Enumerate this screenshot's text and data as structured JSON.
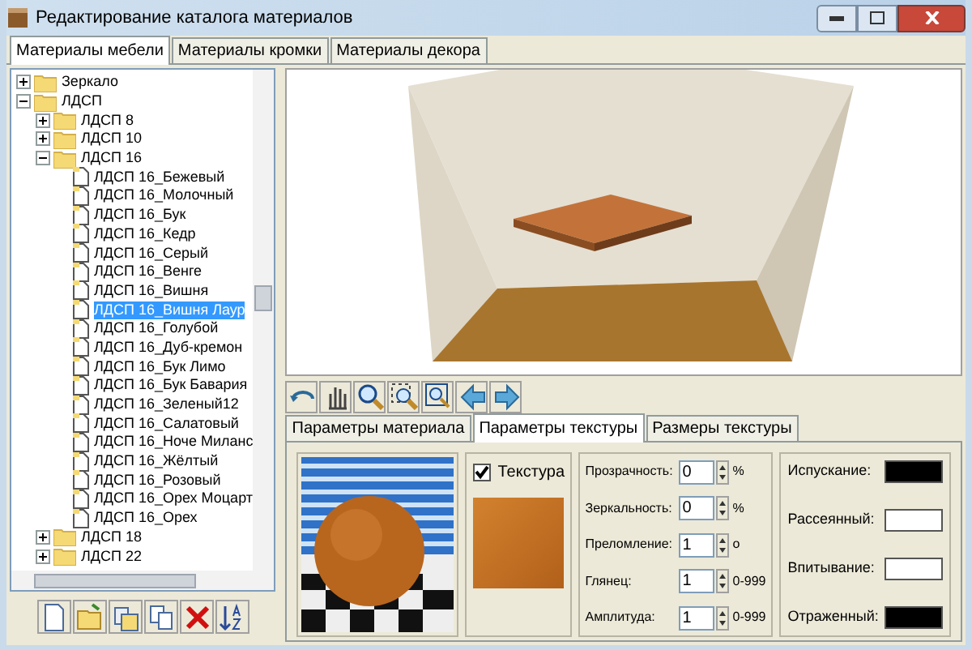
{
  "window": {
    "title": "Редактирование каталога материалов"
  },
  "tabs": [
    {
      "label": "Материалы мебели",
      "selected": true
    },
    {
      "label": "Материалы кромки",
      "selected": false
    },
    {
      "label": "Материалы декора",
      "selected": false
    }
  ],
  "tree": [
    {
      "kind": "folder",
      "label": "Зеркало",
      "expanded": false,
      "selected": false
    },
    {
      "kind": "folder",
      "label": "ЛДСП",
      "expanded": true,
      "selected": false,
      "children": [
        {
          "kind": "folder",
          "label": "ЛДСП 8",
          "expanded": false,
          "selected": false
        },
        {
          "kind": "folder",
          "label": "ЛДСП 10",
          "expanded": false,
          "selected": false
        },
        {
          "kind": "folder",
          "label": "ЛДСП 16",
          "expanded": true,
          "selected": false,
          "children": [
            {
              "kind": "material",
              "label": "ЛДСП 16_Бежевый",
              "selected": false
            },
            {
              "kind": "material",
              "label": "ЛДСП 16_Молочный",
              "selected": false
            },
            {
              "kind": "material",
              "label": "ЛДСП 16_Бук",
              "selected": false
            },
            {
              "kind": "material",
              "label": "ЛДСП 16_Кедр",
              "selected": false
            },
            {
              "kind": "material",
              "label": "ЛДСП 16_Серый",
              "selected": false
            },
            {
              "kind": "material",
              "label": "ЛДСП 16_Венге",
              "selected": false
            },
            {
              "kind": "material",
              "label": "ЛДСП 16_Вишня",
              "selected": false
            },
            {
              "kind": "material",
              "label": "ЛДСП 16_Вишня Лаур",
              "selected": true
            },
            {
              "kind": "material",
              "label": "ЛДСП 16_Голубой",
              "selected": false
            },
            {
              "kind": "material",
              "label": "ЛДСП 16_Дуб-кремон",
              "selected": false
            },
            {
              "kind": "material",
              "label": "ЛДСП 16_Бук Лимо",
              "selected": false
            },
            {
              "kind": "material",
              "label": "ЛДСП 16_Бук Бавария",
              "selected": false
            },
            {
              "kind": "material",
              "label": "ЛДСП 16_Зеленый12",
              "selected": false
            },
            {
              "kind": "material",
              "label": "ЛДСП 16_Салатовый",
              "selected": false
            },
            {
              "kind": "material",
              "label": "ЛДСП 16_Ноче Миланс",
              "selected": false
            },
            {
              "kind": "material",
              "label": "ЛДСП 16_Жёлтый",
              "selected": false
            },
            {
              "kind": "material",
              "label": "ЛДСП 16_Розовый",
              "selected": false
            },
            {
              "kind": "material",
              "label": "ЛДСП 16_Орех Моцарт",
              "selected": false
            },
            {
              "kind": "material",
              "label": "ЛДСП 16_Орех",
              "selected": false
            }
          ]
        },
        {
          "kind": "folder",
          "label": "ЛДСП 18",
          "expanded": false,
          "selected": false
        },
        {
          "kind": "folder",
          "label": "ЛДСП 22",
          "expanded": false,
          "selected": false
        }
      ]
    }
  ],
  "view_tabs": [
    {
      "label": "Параметры материала",
      "selected": false
    },
    {
      "label": "Параметры текстуры",
      "selected": true
    },
    {
      "label": "Размеры текстуры",
      "selected": false
    }
  ],
  "texture": {
    "label": "Текстура",
    "checked": true
  },
  "params": [
    {
      "label": "Прозрачность:",
      "value": "0",
      "unit": "%"
    },
    {
      "label": "Зеркальность:",
      "value": "0",
      "unit": "%"
    },
    {
      "label": "Преломление:",
      "value": "1",
      "unit": "o"
    },
    {
      "label": "Глянец:",
      "value": "1",
      "unit": "0-999"
    },
    {
      "label": "Амплитуда:",
      "value": "1",
      "unit": "0-999"
    }
  ],
  "colors": [
    {
      "label": "Испускание:",
      "color": "#000000"
    },
    {
      "label": "Рассеянный:",
      "color": "#ffffff"
    },
    {
      "label": "Впитывание:",
      "color": "#ffffff"
    },
    {
      "label": "Отраженный:",
      "color": "#000000"
    }
  ]
}
